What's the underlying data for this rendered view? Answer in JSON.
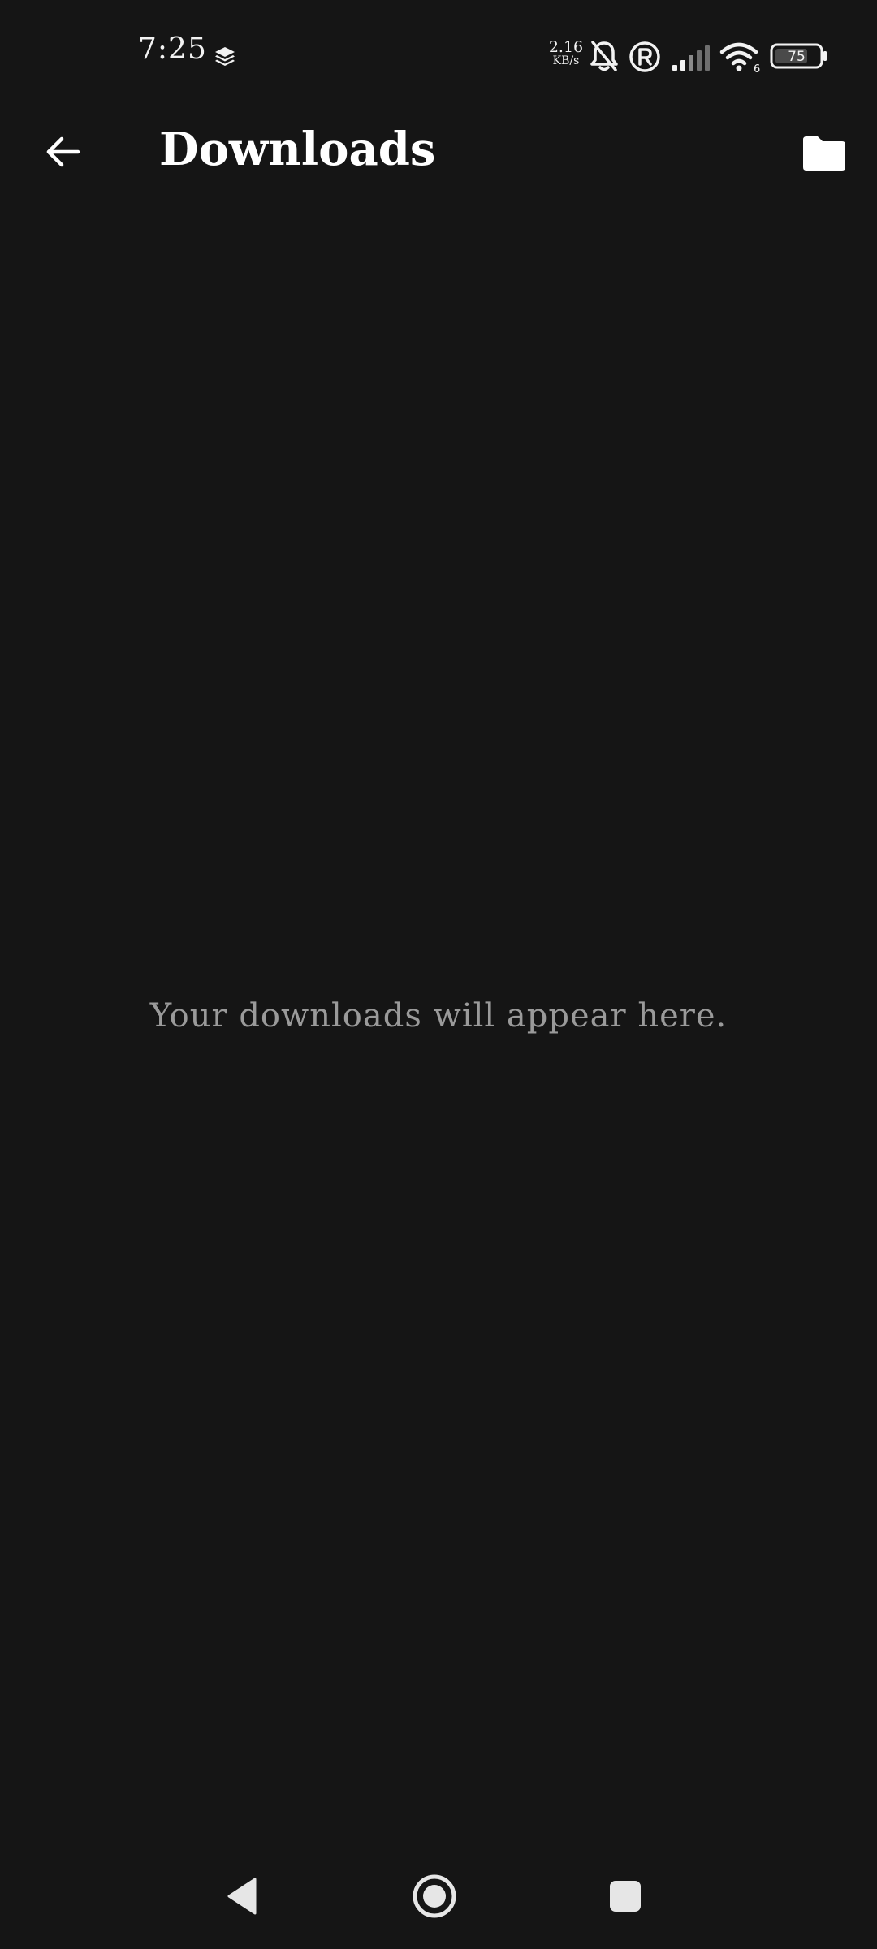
{
  "status_bar": {
    "time": "7:25",
    "net_speed_value": "2.16",
    "net_speed_unit": "KB/s",
    "wifi_badge": "6",
    "battery_level": "75",
    "icons": [
      "layers-icon",
      "bell-off-icon",
      "registered-icon",
      "signal-icon",
      "wifi-icon",
      "battery-icon"
    ]
  },
  "header": {
    "title": "Downloads",
    "back_icon": "arrow-left-icon",
    "action_icon": "folder-icon"
  },
  "main": {
    "empty_message": "Your downloads will appear here."
  },
  "nav_bar": {
    "icons": [
      "back-triangle-icon",
      "home-circle-icon",
      "recents-square-icon"
    ]
  },
  "colors": {
    "background": "#151515",
    "text_primary": "#ffffff",
    "text_secondary": "#9a9a9a"
  }
}
